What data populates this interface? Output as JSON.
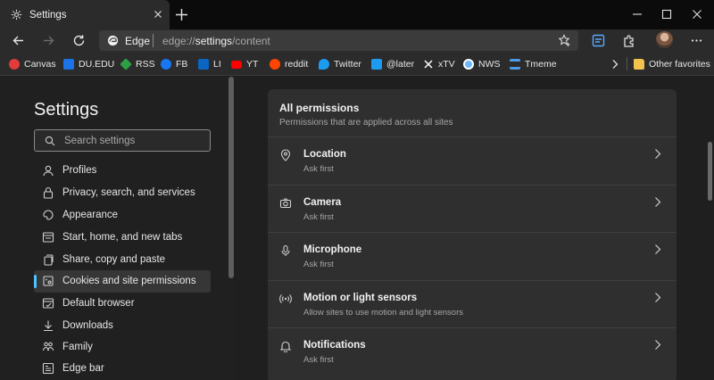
{
  "tab": {
    "title": "Settings"
  },
  "omnibox": {
    "site_label": "Edge",
    "url_prefix": "edge://",
    "url_strong": "settings",
    "url_suffix": "/content"
  },
  "favorites": {
    "items": [
      {
        "label": "Canvas",
        "icon": "canvas-icon",
        "color": "#e23b3b"
      },
      {
        "label": "DU.EDU",
        "icon": "du-icon",
        "color": "#1a73e8"
      },
      {
        "label": "RSS",
        "icon": "rss-icon",
        "color": "#2e9e45"
      },
      {
        "label": "FB",
        "icon": "facebook-icon",
        "color": "#1877f2"
      },
      {
        "label": "LI",
        "icon": "linkedin-icon",
        "color": "#0a66c2"
      },
      {
        "label": "YT",
        "icon": "youtube-icon",
        "color": "#ff0000"
      },
      {
        "label": "reddit",
        "icon": "reddit-icon",
        "color": "#ff4500"
      },
      {
        "label": "Twitter",
        "icon": "twitter-icon",
        "color": "#1d9bf0"
      },
      {
        "label": "@later",
        "icon": "twitter-icon",
        "color": "#1d9bf0"
      },
      {
        "label": "xTV",
        "icon": "x-icon",
        "color": "#ffffff"
      },
      {
        "label": "NWS",
        "icon": "nws-icon",
        "color": "#6ab8ff"
      },
      {
        "label": "Tmeme",
        "icon": "tmeme-icon",
        "color": "#4a9be8"
      }
    ],
    "other_favorites": "Other favorites"
  },
  "sidebar": {
    "title": "Settings",
    "search_placeholder": "Search settings",
    "items": [
      {
        "label": "Profiles",
        "icon": "profile-icon",
        "active": false
      },
      {
        "label": "Privacy, search, and services",
        "icon": "lock-icon",
        "active": false
      },
      {
        "label": "Appearance",
        "icon": "appearance-icon",
        "active": false
      },
      {
        "label": "Start, home, and new tabs",
        "icon": "home-tabs-icon",
        "active": false
      },
      {
        "label": "Share, copy and paste",
        "icon": "share-icon",
        "active": false
      },
      {
        "label": "Cookies and site permissions",
        "icon": "cookies-icon",
        "active": true
      },
      {
        "label": "Default browser",
        "icon": "default-browser-icon",
        "active": false
      },
      {
        "label": "Downloads",
        "icon": "download-icon",
        "active": false
      },
      {
        "label": "Family",
        "icon": "family-icon",
        "active": false
      },
      {
        "label": "Edge bar",
        "icon": "edge-bar-icon",
        "active": false
      }
    ]
  },
  "permissions": {
    "title": "All permissions",
    "subtitle": "Permissions that are applied across all sites",
    "rows": [
      {
        "name": "Location",
        "desc": "Ask first",
        "icon": "location-icon"
      },
      {
        "name": "Camera",
        "desc": "Ask first",
        "icon": "camera-icon"
      },
      {
        "name": "Microphone",
        "desc": "Ask first",
        "icon": "microphone-icon"
      },
      {
        "name": "Motion or light sensors",
        "desc": "Allow sites to use motion and light sensors",
        "icon": "sensors-icon"
      },
      {
        "name": "Notifications",
        "desc": "Ask first",
        "icon": "bell-icon"
      }
    ]
  },
  "colors": {
    "accent": "#4cc2ff",
    "background": "#1f1f1f",
    "card": "#2f2f2f"
  }
}
